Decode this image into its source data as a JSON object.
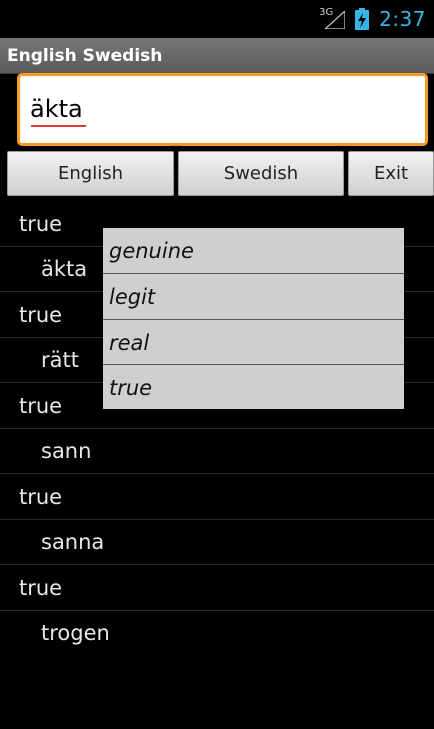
{
  "status": {
    "network": "3G",
    "time": "2:37"
  },
  "app": {
    "title": "English Swedish"
  },
  "search": {
    "value": "äkta"
  },
  "buttons": {
    "english": "English",
    "swedish": "Swedish",
    "exit": "Exit"
  },
  "results": [
    {
      "en": "true",
      "sv": "äkta"
    },
    {
      "en": "true",
      "sv": "rätt"
    },
    {
      "en": "true",
      "sv": "sann"
    },
    {
      "en": "true",
      "sv": "sanna"
    },
    {
      "en": "true",
      "sv": "trogen"
    }
  ],
  "popup": {
    "items": [
      "genuine",
      "legit",
      "real",
      "true"
    ]
  },
  "colors": {
    "accent": "#33b5e5",
    "input_border": "#f79a2a"
  }
}
